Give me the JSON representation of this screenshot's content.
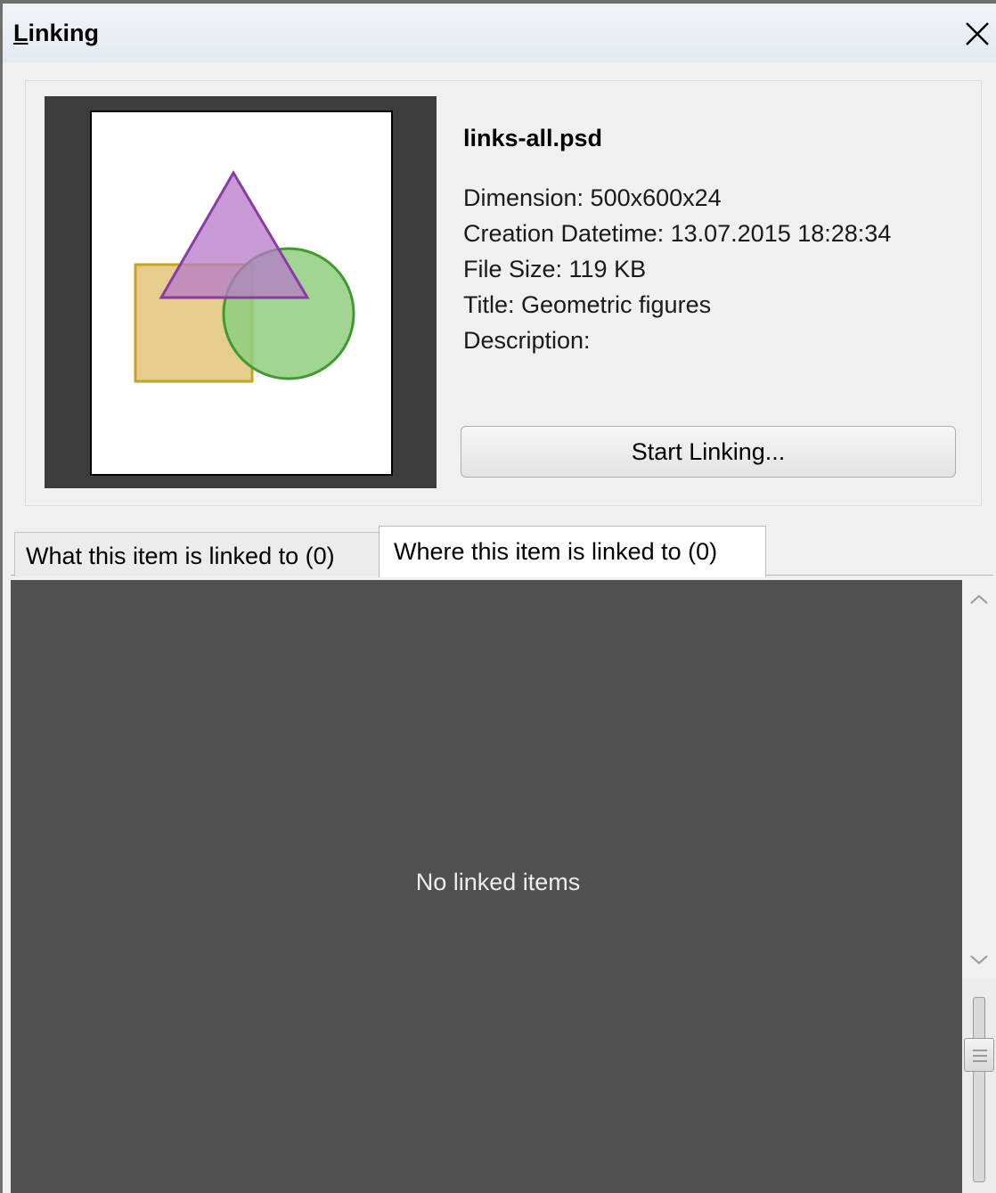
{
  "window": {
    "title_mnemonic": "L",
    "title_rest": "inking",
    "close_icon": "close-icon"
  },
  "info": {
    "filename": "links-all.psd",
    "dimension": "Dimension: 500x600x24",
    "creation": "Creation Datetime: 13.07.2015 18:28:34",
    "filesize": "File Size: 119 KB",
    "title": "Title: Geometric figures",
    "description": "Description:",
    "start_button": "Start Linking..."
  },
  "tabs": [
    {
      "label": "What this item is linked to (0)",
      "active": false
    },
    {
      "label": "Where this item is linked to (0)",
      "active": true
    }
  ],
  "list": {
    "empty_message": "No linked items"
  },
  "colors": {
    "list_background": "#505050",
    "preview_background": "#3c3c3c",
    "triangle": "#b57ac9",
    "square": "#e2c983",
    "circle": "#8fcf7f"
  },
  "scrollbar": {
    "up_icon": "chevron-up-icon",
    "down_icon": "chevron-down-icon"
  }
}
